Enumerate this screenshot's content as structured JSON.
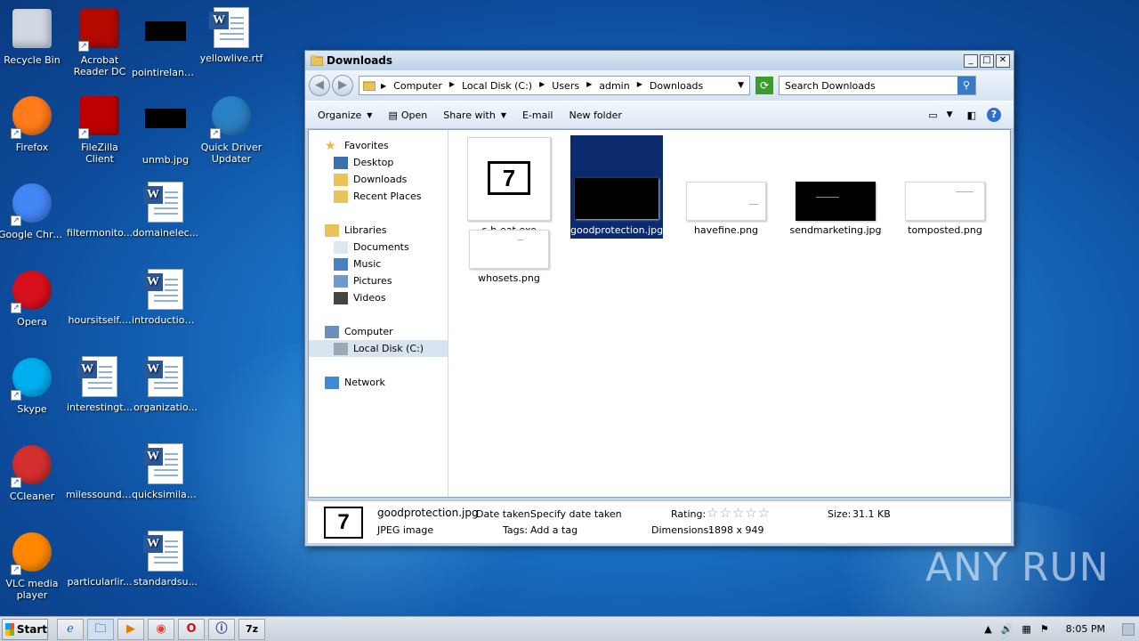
{
  "desktop": {
    "icons": [
      {
        "label": "Recycle Bin",
        "icon": "recycle-bin-icon"
      },
      {
        "label": "Acrobat Reader DC",
        "icon": "acrobat-icon"
      },
      {
        "label": "pointireland...",
        "icon": "black-thumbnail-icon"
      },
      {
        "label": "yellowlive.rtf",
        "icon": "word-doc-icon"
      },
      {
        "label": "Firefox",
        "icon": "firefox-icon"
      },
      {
        "label": "FileZilla Client",
        "icon": "filezilla-icon"
      },
      {
        "label": "unmb.jpg",
        "icon": "black-thumbnail-icon"
      },
      {
        "label": "Quick Driver Updater",
        "icon": "driver-updater-icon"
      },
      {
        "label": "Google Chrome",
        "icon": "chrome-icon"
      },
      {
        "label": "filtermonito...",
        "icon": "blank-file-icon"
      },
      {
        "label": "domainelec...",
        "icon": "word-doc-icon"
      },
      {
        "label": "Opera",
        "icon": "opera-icon"
      },
      {
        "label": "hoursitself....",
        "icon": "blank-file-icon"
      },
      {
        "label": "introduction...",
        "icon": "word-doc-icon"
      },
      {
        "label": "Skype",
        "icon": "skype-icon"
      },
      {
        "label": "interestingt...",
        "icon": "word-doc-icon"
      },
      {
        "label": "organizatio...",
        "icon": "word-doc-icon"
      },
      {
        "label": "CCleaner",
        "icon": "ccleaner-icon"
      },
      {
        "label": "milessound....",
        "icon": "blank-file-icon"
      },
      {
        "label": "quicksimilar.rtf",
        "icon": "word-doc-icon"
      },
      {
        "label": "VLC media player",
        "icon": "vlc-icon"
      },
      {
        "label": "particularlir...",
        "icon": "blank-file-icon"
      },
      {
        "label": "standardsu...",
        "icon": "word-doc-icon"
      }
    ]
  },
  "window": {
    "title": "Downloads",
    "address": [
      "Computer",
      "Local Disk (C:)",
      "Users",
      "admin",
      "Downloads"
    ],
    "search_placeholder": "Search Downloads",
    "commands": [
      "Organize",
      "Open",
      "Share with",
      "E-mail",
      "New folder"
    ],
    "nav": [
      {
        "label": "Favorites",
        "icon": "star-icon"
      },
      {
        "label": "Desktop",
        "icon": "desktop-icon"
      },
      {
        "label": "Downloads",
        "icon": "downloads-folder-icon"
      },
      {
        "label": "Recent Places",
        "icon": "recent-places-icon"
      },
      {
        "label": "Libraries",
        "icon": "libraries-icon"
      },
      {
        "label": "Documents",
        "icon": "documents-icon"
      },
      {
        "label": "Music",
        "icon": "music-icon"
      },
      {
        "label": "Pictures",
        "icon": "pictures-icon"
      },
      {
        "label": "Videos",
        "icon": "videos-icon"
      },
      {
        "label": "Computer",
        "icon": "computer-icon"
      },
      {
        "label": "Local Disk (C:)",
        "icon": "disk-icon"
      },
      {
        "label": "Network",
        "icon": "network-icon"
      }
    ],
    "files": [
      {
        "name": "c-h-eat.exe",
        "icon": "exe-icon"
      },
      {
        "name": "goodprotection.jpg",
        "icon": "image-thumbnail"
      },
      {
        "name": "havefine.png",
        "icon": "image-thumbnail"
      },
      {
        "name": "sendmarketing.jpg",
        "icon": "image-thumbnail"
      },
      {
        "name": "tomposted.png",
        "icon": "image-thumbnail"
      },
      {
        "name": "whosets.png",
        "icon": "image-thumbnail"
      }
    ],
    "details": {
      "name": "goodprotection.jpg",
      "type": "JPEG image",
      "date_label": "Date taken:",
      "date_value": "Specify date taken",
      "tags_label": "Tags:",
      "tags_value": "Add a tag",
      "rating_label": "Rating:",
      "dimensions_label": "Dimensions:",
      "dimensions_value": "1898 x 949",
      "size_label": "Size:",
      "size_value": "31.1 KB"
    }
  },
  "taskbar": {
    "start_label": "Start",
    "clock": "8:05 PM"
  },
  "watermark": "ANY RUN"
}
